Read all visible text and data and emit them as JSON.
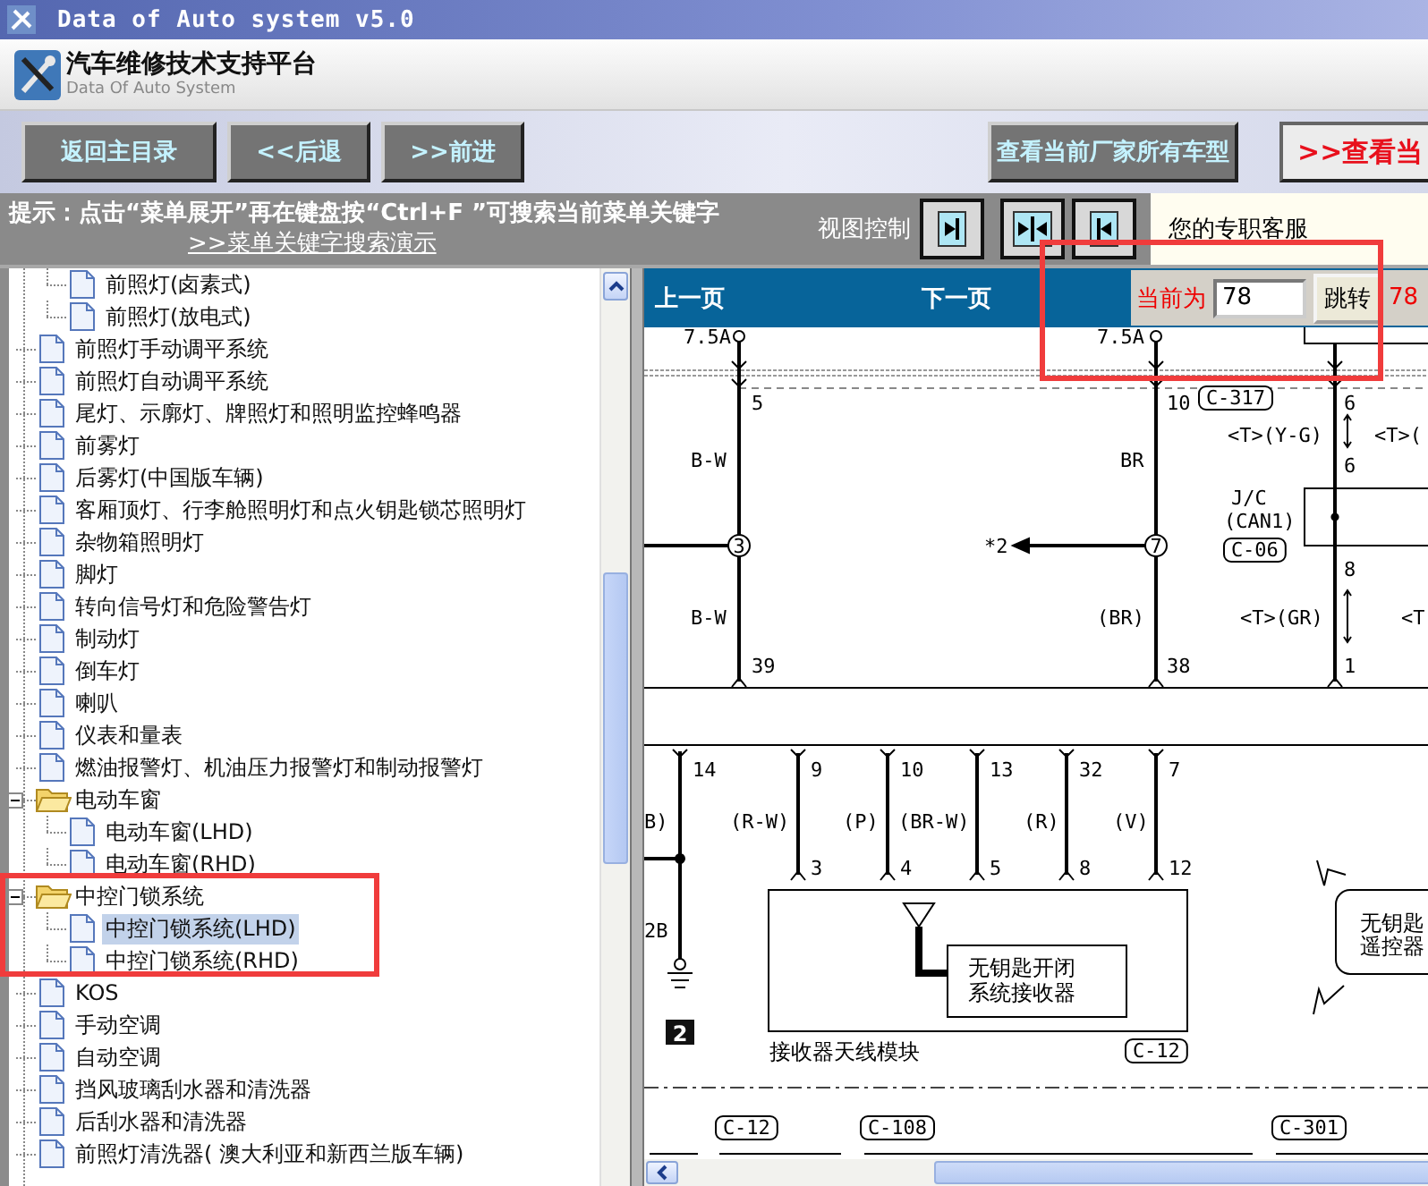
{
  "window": {
    "title": "Data of Auto system v5.0"
  },
  "header": {
    "title": "汽车维修技术支持平台",
    "subtitle": "Data Of Auto System"
  },
  "toolbar": {
    "left_buttons": [
      "返回主目录",
      "<<后退",
      ">>前进"
    ],
    "right_buttons": [
      {
        "label": "查看当前厂家所有车型",
        "kind": "normal"
      },
      {
        "label": ">>查看当",
        "kind": "highlight"
      }
    ]
  },
  "hint": {
    "text": "提示：点击“菜单展开”再在键盘按“Ctrl+F ”可搜索当前菜单关键字",
    "link": ">>菜单关键字搜索演示",
    "view_control_label": "视图控制",
    "service_label": "您的专职客服"
  },
  "tree": [
    {
      "kind": "continued",
      "children": [
        {
          "kind": "page",
          "label": "前照灯(卤素式)",
          "selected": false
        },
        {
          "kind": "page",
          "label": "前照灯(放电式)",
          "selected": false
        }
      ]
    },
    {
      "kind": "page",
      "label": "前照灯手动调平系统",
      "selected": false
    },
    {
      "kind": "page",
      "label": "前照灯自动调平系统",
      "selected": false
    },
    {
      "kind": "page",
      "label": "尾灯、示廓灯、牌照灯和照明监控蜂鸣器",
      "selected": false
    },
    {
      "kind": "page",
      "label": "前雾灯",
      "selected": false
    },
    {
      "kind": "page",
      "label": "后雾灯(中国版车辆)",
      "selected": false
    },
    {
      "kind": "page",
      "label": "客厢顶灯、行李舱照明灯和点火钥匙锁芯照明灯",
      "selected": false
    },
    {
      "kind": "page",
      "label": "杂物箱照明灯",
      "selected": false
    },
    {
      "kind": "page",
      "label": "脚灯",
      "selected": false
    },
    {
      "kind": "page",
      "label": "转向信号灯和危险警告灯",
      "selected": false
    },
    {
      "kind": "page",
      "label": "制动灯",
      "selected": false
    },
    {
      "kind": "page",
      "label": "倒车灯",
      "selected": false
    },
    {
      "kind": "page",
      "label": "喇叭",
      "selected": false
    },
    {
      "kind": "page",
      "label": "仪表和量表",
      "selected": false
    },
    {
      "kind": "page",
      "label": "燃油报警灯、机油压力报警灯和制动报警灯",
      "selected": false
    },
    {
      "kind": "folder",
      "label": "电动车窗",
      "expanded": true,
      "selected": false,
      "children": [
        {
          "kind": "page",
          "label": "电动车窗(LHD)",
          "selected": false
        },
        {
          "kind": "page",
          "label": "电动车窗(RHD)",
          "selected": false
        }
      ]
    },
    {
      "kind": "folder",
      "label": "中控门锁系统",
      "expanded": true,
      "selected": false,
      "children": [
        {
          "kind": "page",
          "label": "中控门锁系统(LHD)",
          "selected": true
        },
        {
          "kind": "page",
          "label": "中控门锁系统(RHD)",
          "selected": false
        }
      ]
    },
    {
      "kind": "page",
      "label": "KOS",
      "selected": false
    },
    {
      "kind": "page",
      "label": "手动空调",
      "selected": false
    },
    {
      "kind": "page",
      "label": "自动空调",
      "selected": false
    },
    {
      "kind": "page",
      "label": "挡风玻璃刮水器和清洗器",
      "selected": false
    },
    {
      "kind": "page",
      "label": "后刮水器和清洗器",
      "selected": false
    },
    {
      "kind": "page",
      "label": "前照灯清洗器( 澳大利亚和新西兰版车辆)",
      "selected": false
    }
  ],
  "viewer": {
    "prev": "上一页",
    "next": "下一页",
    "current_label": "当前为",
    "page_input": "78",
    "jump_button": "跳转",
    "total": "78"
  },
  "diagram": {
    "labels": [
      {
        "kind": "text",
        "text": "7.5A"
      },
      {
        "kind": "text",
        "text": "7.5A"
      },
      {
        "kind": "text",
        "text": "5"
      },
      {
        "kind": "text",
        "text": "10"
      },
      {
        "kind": "connector",
        "text": "C-317"
      },
      {
        "kind": "text",
        "text": "6"
      },
      {
        "kind": "text",
        "text": "<T>(Y-G)"
      },
      {
        "kind": "text",
        "text": "<T>("
      },
      {
        "kind": "text",
        "text": "B-W"
      },
      {
        "kind": "text",
        "text": "BR"
      },
      {
        "kind": "text",
        "text": "6"
      },
      {
        "kind": "text",
        "text": "J/C"
      },
      {
        "kind": "text",
        "text": "(CAN1)"
      },
      {
        "kind": "splice",
        "text": "3"
      },
      {
        "kind": "text",
        "text": "*2"
      },
      {
        "kind": "splice",
        "text": "7"
      },
      {
        "kind": "connector",
        "text": "C-06"
      },
      {
        "kind": "text",
        "text": "8"
      },
      {
        "kind": "text",
        "text": "B-W"
      },
      {
        "kind": "text",
        "text": "(BR)"
      },
      {
        "kind": "text",
        "text": "<T>(GR)"
      },
      {
        "kind": "text",
        "text": "<T"
      },
      {
        "kind": "text",
        "text": "39"
      },
      {
        "kind": "text",
        "text": "38"
      },
      {
        "kind": "text",
        "text": "1"
      },
      {
        "kind": "text",
        "text": "14"
      },
      {
        "kind": "text",
        "text": "9"
      },
      {
        "kind": "text",
        "text": "10"
      },
      {
        "kind": "text",
        "text": "13"
      },
      {
        "kind": "text",
        "text": "32"
      },
      {
        "kind": "text",
        "text": "7"
      },
      {
        "kind": "text",
        "text": "B)"
      },
      {
        "kind": "text",
        "text": "(R-W)"
      },
      {
        "kind": "text",
        "text": "(P)"
      },
      {
        "kind": "text",
        "text": "(BR-W)"
      },
      {
        "kind": "text",
        "text": "(R)"
      },
      {
        "kind": "text",
        "text": "(V)"
      },
      {
        "kind": "text",
        "text": "3"
      },
      {
        "kind": "text",
        "text": "4"
      },
      {
        "kind": "text",
        "text": "5"
      },
      {
        "kind": "text",
        "text": "8"
      },
      {
        "kind": "text",
        "text": "12"
      },
      {
        "kind": "text",
        "text": "2B"
      },
      {
        "kind": "caption",
        "text": "无钥匙开闭"
      },
      {
        "kind": "caption",
        "text": "系统接收器"
      },
      {
        "kind": "caption",
        "text": "无钥匙"
      },
      {
        "kind": "caption",
        "text": "遥控器"
      },
      {
        "kind": "mark",
        "text": "2"
      },
      {
        "kind": "caption",
        "text": "接收器天线模块"
      },
      {
        "kind": "connector",
        "text": "C-12"
      },
      {
        "kind": "connector",
        "text": "C-12"
      },
      {
        "kind": "connector",
        "text": "C-108"
      },
      {
        "kind": "connector",
        "text": "C-301"
      }
    ]
  }
}
